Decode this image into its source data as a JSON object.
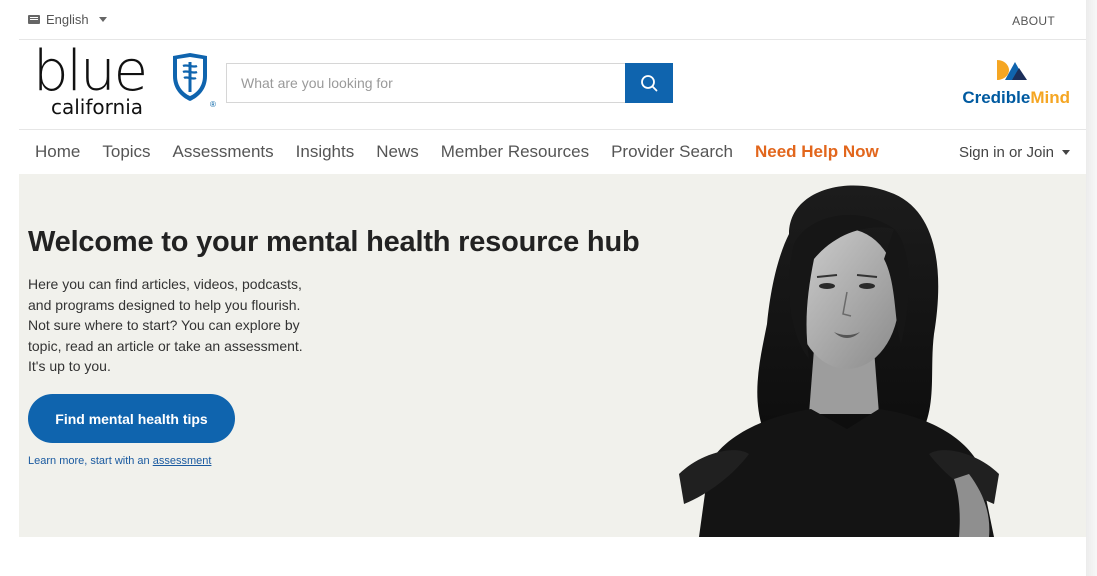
{
  "topbar": {
    "language": "English",
    "about": "ABOUT"
  },
  "logo": {
    "word": "blue",
    "sub": "california",
    "reg": "®"
  },
  "search": {
    "placeholder": "What are you looking for"
  },
  "partner": {
    "name_a": "Credible",
    "name_b": "Mind"
  },
  "nav": {
    "items": [
      "Home",
      "Topics",
      "Assessments",
      "Insights",
      "News",
      "Member Resources",
      "Provider Search"
    ],
    "help": "Need Help Now",
    "signin": "Sign in or Join"
  },
  "hero": {
    "title": "Welcome to your mental health resource hub",
    "body_lines": [
      "Here you can find articles, videos, podcasts,",
      "and programs designed to help you flourish.",
      "Not sure where to start? You can explore by",
      "topic, read an article or take an assessment.",
      "It's up to you."
    ],
    "cta": "Find mental health tips",
    "learn_prefix": "Learn more, start with an",
    "learn_link": "assessment"
  },
  "colors": {
    "brand_blue": "#0f64ae",
    "help_orange": "#e2661c",
    "hero_bg": "#f1f1ec",
    "mind_gold": "#f5a623"
  },
  "icons": [
    "keyboard-icon",
    "chevron-down-icon",
    "shield-logo-icon",
    "search-icon",
    "crediblemind-logo-icon"
  ]
}
